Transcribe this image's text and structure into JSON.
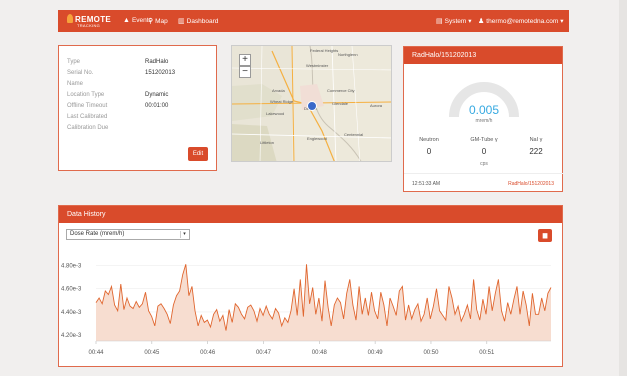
{
  "nav": {
    "brand": "REMOTE",
    "brand_sub": "TRACKING",
    "links": [
      "Events",
      "Map",
      "Dashboard"
    ],
    "system": "System",
    "user": "thermo@remotedna.com"
  },
  "details": {
    "rows": [
      {
        "label": "Type",
        "value": "RadHalo"
      },
      {
        "label": "Serial No.",
        "value": "151202013"
      },
      {
        "label": "Name",
        "value": ""
      },
      {
        "label": "Location Type",
        "value": "Dynamic"
      },
      {
        "label": "Offline Timeout",
        "value": "00:01:00"
      },
      {
        "label": "Last Calibrated",
        "value": ""
      },
      {
        "label": "Calibration Due",
        "value": ""
      }
    ],
    "edit": "Edit"
  },
  "map": {
    "zoom_in": "+",
    "zoom_out": "−",
    "places": [
      {
        "name": "Federal Heights"
      },
      {
        "name": "Northglenn"
      },
      {
        "name": "Arvada"
      },
      {
        "name": "Westminster"
      },
      {
        "name": "Wheat Ridge"
      },
      {
        "name": "Commerce City"
      },
      {
        "name": "Denver"
      },
      {
        "name": "Lakewood"
      },
      {
        "name": "Glendale"
      },
      {
        "name": "Aurora"
      },
      {
        "name": "Englewood"
      },
      {
        "name": "Centennial"
      },
      {
        "name": "Littleton"
      }
    ]
  },
  "device": {
    "title": "RadHalo/151202013",
    "dose": "0.005",
    "dose_unit": "mrem/h",
    "stats": [
      {
        "label": "Neutron",
        "value": "0"
      },
      {
        "label": "GM-Tube γ",
        "value": "0"
      },
      {
        "label": "NaI γ",
        "value": "222"
      }
    ],
    "cps": "cps",
    "time": "12:51:33 AM",
    "link": "RadHalo/151202013",
    "gauge_fraction": 0.0
  },
  "history": {
    "title": "Data History",
    "select": "Dose Rate (mrem/h)"
  },
  "chart_data": {
    "type": "area",
    "xlabels": [
      "00:44",
      "00:45",
      "00:46",
      "00:47",
      "00:48",
      "00:49",
      "00:50",
      "00:51"
    ],
    "ytick_labels": [
      "4.20e-3",
      "4.40e-3",
      "4.60e-3",
      "4.80e-3"
    ],
    "yticks": [
      0.0042,
      0.0044,
      0.0046,
      0.0048
    ],
    "ylim": [
      0.00415,
      0.00495
    ],
    "x_range": [
      0,
      8.15
    ],
    "values": [
      0.00448,
      0.00452,
      0.00447,
      0.00458,
      0.00455,
      0.00462,
      0.00446,
      0.00441,
      0.00464,
      0.00442,
      0.00452,
      0.00445,
      0.00443,
      0.00449,
      0.00444,
      0.00447,
      0.00457,
      0.00441,
      0.00436,
      0.00428,
      0.00445,
      0.00447,
      0.00443,
      0.00438,
      0.0043,
      0.00446,
      0.00454,
      0.00458,
      0.00472,
      0.00481,
      0.00454,
      0.00462,
      0.00441,
      0.00428,
      0.00437,
      0.00431,
      0.00433,
      0.00427,
      0.00438,
      0.00442,
      0.00432,
      0.00437,
      0.00424,
      0.00442,
      0.00431,
      0.00447,
      0.00444,
      0.00438,
      0.00434,
      0.00444,
      0.00446,
      0.00441,
      0.00432,
      0.00443,
      0.00437,
      0.00445,
      0.00438,
      0.00434,
      0.00443,
      0.00439,
      0.00428,
      0.00435,
      0.00431,
      0.00441,
      0.0046,
      0.00437,
      0.00468,
      0.00436,
      0.00481,
      0.00447,
      0.00461,
      0.00438,
      0.00452,
      0.00432,
      0.00467,
      0.00444,
      0.00428,
      0.00446,
      0.00452,
      0.00448,
      0.00434,
      0.00456,
      0.00468,
      0.00446,
      0.00433,
      0.00462,
      0.00438,
      0.00452,
      0.00437,
      0.00457,
      0.00441,
      0.00434,
      0.00457,
      0.00446,
      0.00428,
      0.00452,
      0.00445,
      0.00437,
      0.00458,
      0.00462,
      0.00433,
      0.00446,
      0.00434,
      0.00442,
      0.00447,
      0.00432,
      0.00438,
      0.00452,
      0.00434,
      0.00445,
      0.0046,
      0.00441,
      0.00437,
      0.00433,
      0.00462,
      0.00452,
      0.00438,
      0.00445,
      0.00432,
      0.00438,
      0.00446,
      0.00434,
      0.00468,
      0.00442,
      0.00433,
      0.00451,
      0.00438,
      0.00462,
      0.00441,
      0.00456,
      0.00468,
      0.00441,
      0.00432,
      0.00448,
      0.00438,
      0.00451,
      0.00462,
      0.00438,
      0.00458,
      0.00446,
      0.00428,
      0.00456,
      0.00438,
      0.00438,
      0.00452,
      0.00441,
      0.00456,
      0.00461
    ],
    "color": "#e0662f",
    "fill": "#f7ddd0"
  },
  "colors": {
    "accent": "#d94b2b",
    "gauge": "#36a9e1"
  }
}
